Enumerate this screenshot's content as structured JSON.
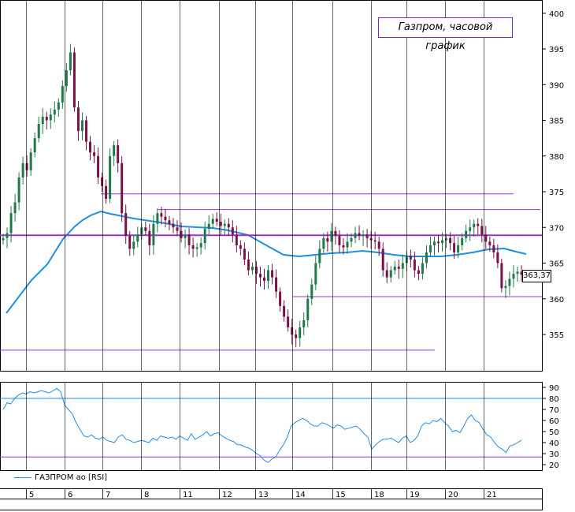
{
  "title": "Газпром, часовой график",
  "legend_label": "ГАЗПРОМ ао [RSI]",
  "last_price_label": "363,37",
  "colors": {
    "up_candle": "#1f7a4a",
    "down_candle": "#7a1248",
    "ma_line": "#1f8ee0",
    "level_line": "#9b30d9",
    "rsi_line": "#1f8ee0",
    "rsi_level_upper": "#1f8ee0",
    "rsi_level_lower": "#9b30d9"
  },
  "chart_data": [
    {
      "type": "candlestick",
      "title": "Газпром, часовой график",
      "y_ticks": [
        "355",
        "360",
        "365",
        "370",
        "375",
        "380",
        "385",
        "390",
        "395",
        "400"
      ],
      "ylim": [
        352,
        401
      ],
      "x_tick_labels": [
        "5",
        "6",
        "7",
        "8",
        "11",
        "12",
        "13",
        "14",
        "15",
        "18",
        "19",
        "20",
        "21"
      ],
      "horizontal_levels": [
        374.7,
        372.5,
        368.9,
        360.3,
        352.8
      ],
      "last_price": 363.37,
      "closes": [
        368.5,
        369.2,
        372,
        373.5,
        377,
        379,
        378,
        380.5,
        382.5,
        384.5,
        385.5,
        385,
        385.8,
        386.5,
        387.5,
        389.8,
        392,
        394.5,
        386.8,
        383.5,
        385,
        382,
        380.5,
        380,
        377,
        375.8,
        374,
        380,
        381.5,
        379,
        372,
        368.8,
        367,
        368,
        369,
        370,
        369.5,
        367.5,
        370.5,
        372,
        371.5,
        371,
        370.5,
        370,
        369.5,
        368.5,
        369,
        367.5,
        367,
        367.2,
        367.8,
        369.8,
        370.5,
        371.2,
        370.8,
        370.2,
        370.5,
        370,
        369,
        367.5,
        367,
        365.5,
        364,
        364.5,
        363.5,
        363,
        362.5,
        364,
        363,
        361,
        359,
        357.5,
        356,
        355,
        354.5,
        356,
        357,
        360,
        362,
        365,
        367,
        368.5,
        368,
        369.5,
        368.8,
        367.5,
        367.2,
        368,
        368.5,
        369.2,
        368.8,
        369,
        368.5,
        368.2,
        368,
        367,
        364,
        363,
        364,
        364.5,
        364.2,
        365,
        366,
        365.5,
        364,
        363.5,
        365,
        366.5,
        367.5,
        368,
        367.8,
        368.2,
        368.5,
        367.8,
        366.5,
        367.5,
        368.5,
        369.5,
        370,
        370.5,
        370.2,
        369,
        368,
        367.5,
        366.5,
        365,
        361.5,
        361.8,
        362.8,
        363.5,
        363.8,
        363.37
      ],
      "ma_path_points": [
        [
          8,
          397
        ],
        [
          40,
          355
        ],
        [
          60,
          335
        ],
        [
          80,
          303
        ],
        [
          95,
          287
        ],
        [
          105,
          279
        ],
        [
          115,
          273
        ],
        [
          128,
          268
        ],
        [
          140,
          271
        ],
        [
          155,
          274
        ],
        [
          170,
          277
        ],
        [
          190,
          280
        ],
        [
          210,
          283
        ],
        [
          230,
          287
        ],
        [
          250,
          288
        ],
        [
          270,
          289
        ],
        [
          290,
          292
        ],
        [
          315,
          298
        ],
        [
          340,
          312
        ],
        [
          360,
          323
        ],
        [
          380,
          325
        ],
        [
          400,
          323
        ],
        [
          420,
          321
        ],
        [
          440,
          320
        ],
        [
          460,
          318
        ],
        [
          480,
          320
        ],
        [
          500,
          323
        ],
        [
          520,
          325
        ],
        [
          540,
          325
        ],
        [
          560,
          325
        ],
        [
          580,
          323
        ],
        [
          600,
          320
        ],
        [
          620,
          316
        ],
        [
          640,
          315
        ],
        [
          655,
          319
        ],
        [
          668,
          322
        ]
      ]
    },
    {
      "type": "line",
      "series": [
        {
          "name": "ГАЗПРОМ ао [RSI]"
        }
      ],
      "y_ticks": [
        "20",
        "30",
        "40",
        "50",
        "60",
        "70",
        "80",
        "90"
      ],
      "ylim": [
        15,
        93
      ],
      "horizontal_levels": [
        80,
        27
      ],
      "values": [
        70,
        76,
        75,
        80,
        83,
        85,
        84,
        86,
        85,
        86,
        87,
        86,
        85,
        87,
        89,
        86,
        74,
        70,
        66,
        58,
        52,
        46,
        45,
        47,
        44,
        43,
        45,
        42,
        41,
        40,
        45,
        47,
        43,
        42,
        40,
        41,
        42,
        41,
        40,
        44,
        42,
        46,
        45,
        44,
        45,
        43,
        46,
        44,
        42,
        48,
        43,
        45,
        47,
        50,
        46,
        48,
        49,
        46,
        44,
        42,
        41,
        38,
        38,
        36,
        35,
        33,
        30,
        28,
        24,
        22,
        25,
        27,
        33,
        38,
        45,
        55,
        58,
        60,
        62,
        60,
        57,
        55,
        55,
        58,
        57,
        55,
        53,
        56,
        55,
        52,
        53,
        54,
        55,
        52,
        48,
        45,
        34,
        38,
        41,
        43,
        43,
        44,
        42,
        40,
        44,
        46,
        40,
        42,
        46,
        55,
        58,
        57,
        60,
        59,
        62,
        58,
        55,
        50,
        51,
        49,
        55,
        62,
        65,
        60,
        58,
        52,
        47,
        45,
        40,
        36,
        34,
        31,
        37,
        38,
        40,
        42
      ]
    }
  ]
}
